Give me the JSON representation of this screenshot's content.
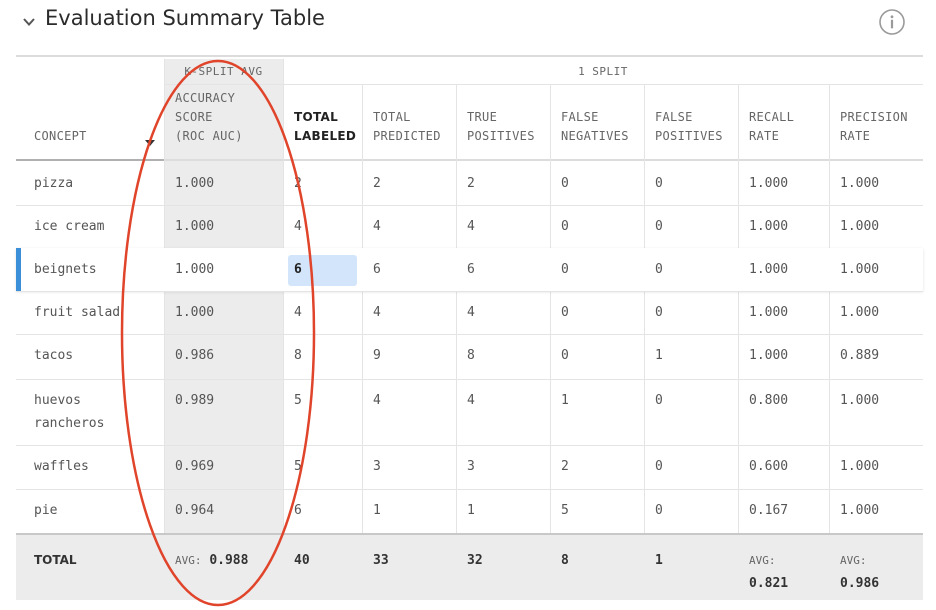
{
  "header": {
    "title": "Evaluation Summary Table"
  },
  "table": {
    "group_kfold": "K-SPLIT AVG",
    "group_split": "1 SPLIT",
    "columns": [
      [
        "CONCEPT"
      ],
      [
        "ACCURACY",
        "SCORE",
        "(ROC AUC)"
      ],
      [
        "TOTAL",
        "LABELED"
      ],
      [
        "TOTAL",
        "PREDICTED"
      ],
      [
        "TRUE",
        "POSITIVES"
      ],
      [
        "FALSE",
        "NEGATIVES"
      ],
      [
        "FALSE",
        "POSITIVES"
      ],
      [
        "RECALL",
        "RATE"
      ],
      [
        "PRECISION",
        "RATE"
      ]
    ],
    "rows": [
      {
        "concept": [
          "pizza"
        ],
        "values": [
          "1.000",
          "2",
          "2",
          "2",
          "0",
          "0",
          "1.000",
          "1.000"
        ]
      },
      {
        "concept": [
          "ice cream"
        ],
        "values": [
          "1.000",
          "4",
          "4",
          "4",
          "0",
          "0",
          "1.000",
          "1.000"
        ]
      },
      {
        "concept": [
          "beignets"
        ],
        "values": [
          "1.000",
          "6",
          "6",
          "6",
          "0",
          "0",
          "1.000",
          "1.000"
        ]
      },
      {
        "concept": [
          "fruit salad"
        ],
        "values": [
          "1.000",
          "4",
          "4",
          "4",
          "0",
          "0",
          "1.000",
          "1.000"
        ]
      },
      {
        "concept": [
          "tacos"
        ],
        "values": [
          "0.986",
          "8",
          "9",
          "8",
          "0",
          "1",
          "1.000",
          "0.889"
        ]
      },
      {
        "concept": [
          "huevos",
          "rancheros"
        ],
        "values": [
          "0.989",
          "5",
          "4",
          "4",
          "1",
          "0",
          "0.800",
          "1.000"
        ]
      },
      {
        "concept": [
          "waffles"
        ],
        "values": [
          "0.969",
          "5",
          "3",
          "3",
          "2",
          "0",
          "0.600",
          "1.000"
        ]
      },
      {
        "concept": [
          "pie"
        ],
        "values": [
          "0.964",
          "6",
          "1",
          "1",
          "5",
          "0",
          "0.167",
          "1.000"
        ]
      }
    ],
    "selected_row": 2,
    "total": {
      "label": "TOTAL",
      "accuracy_prefix": "AVG:",
      "accuracy_value": "0.988",
      "labeled": "40",
      "predicted": "33",
      "true_pos": "32",
      "false_neg": "8",
      "false_pos": "1",
      "recall_prefix": "AVG:",
      "recall_value": "0.821",
      "precision_prefix": "AVG:",
      "precision_value": "0.986"
    }
  },
  "colors": {
    "accent": "#3b8fd9",
    "highlight": "#d3e5fb",
    "annotation": "#e0442a"
  }
}
